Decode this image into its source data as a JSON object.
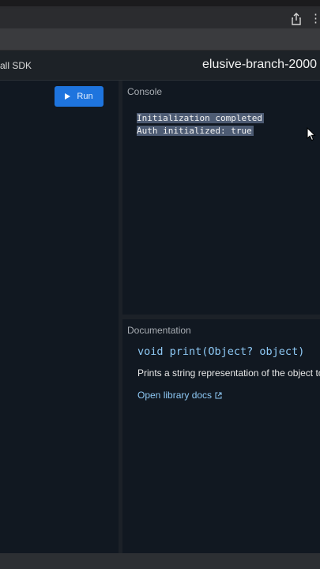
{
  "header": {
    "sdk_label": "all SDK",
    "project_title": "elusive-branch-2000"
  },
  "editor": {
    "run_label": "Run"
  },
  "console": {
    "title": "Console",
    "lines": [
      "Initialization completed",
      "Auth initialized: true"
    ]
  },
  "documentation": {
    "title": "Documentation",
    "signature": "void print(Object? object)",
    "description": "Prints a string representation of the object to",
    "link_label": "Open library docs"
  },
  "browser": {
    "more_glyph": "⋮"
  },
  "colors": {
    "accent": "#1e74de",
    "link": "#8ec9f5",
    "pane_bg": "#111821",
    "selection": "#4d5b73"
  },
  "icons": [
    "share-icon",
    "play-icon",
    "mouse-cursor-icon",
    "open-in-new-icon"
  ]
}
